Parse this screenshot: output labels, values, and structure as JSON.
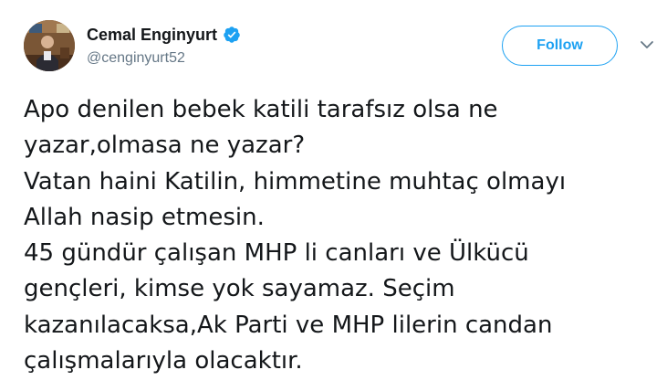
{
  "tweet": {
    "author": {
      "display_name": "Cemal Enginyurt",
      "handle": "@cenginyurt52",
      "verified": true
    },
    "follow_label": "Follow",
    "menu_icon": "chevron-down-icon",
    "text_lines": [
      "Apo denilen bebek katili tarafsız olsa ne",
      "yazar,olmasa ne yazar?",
      "Vatan haini Katilin, himmetine muhtaç olmayı",
      "Allah nasip etmesin.",
      "45 gündür çalışan MHP li canları ve Ülkücü",
      "gençleri, kimse yok sayamaz. Seçim",
      "kazanılacaksa,Ak Parti ve MHP lilerin candan",
      "çalışmalarıyla olacaktır."
    ]
  },
  "colors": {
    "accent": "#1da1f2",
    "text": "#14171a",
    "secondary_text": "#657786",
    "background": "#ffffff"
  }
}
